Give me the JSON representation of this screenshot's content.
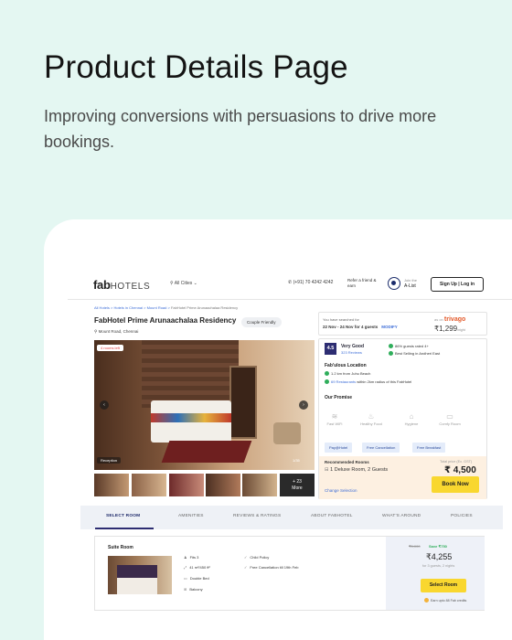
{
  "hero": {
    "title": "Product Details Page",
    "subtitle": "Improving conversions with persuasions to drive more bookings."
  },
  "header": {
    "logo_bold": "fab",
    "logo_rest": "HOTELS",
    "cities": "All Cities",
    "phone": "(+91) 70 4242 4242",
    "refer": "Refer a friend & earn",
    "alist_small": "Join the",
    "alist": "A-List",
    "signin": "Sign Up  |  Log in"
  },
  "breadcrumb": {
    "links": "All Hotels > Hotels in Chennai > Mount Road >",
    "current": "FabHotel Prime Arunaachalaa Residency"
  },
  "hotel": {
    "name": "FabHotel Prime Arunaachalaa Residency",
    "tag": "Couple Friendly",
    "address": "Mount Road, Chennai"
  },
  "gallery": {
    "rooms_left": "4 rooms left",
    "prev": "‹",
    "next": "›",
    "tag": "Reception",
    "counter": "1/35",
    "more_count": "+ 23",
    "more_label": "More"
  },
  "search": {
    "label": "You have searched for",
    "dates": "22 Nov - 24 Nov for 4 guests",
    "modify": "MODIFY",
    "as_on": "as on",
    "trivago": "trivago",
    "price": "₹1,299",
    "per": "/night"
  },
  "rating": {
    "score": "4.5",
    "label": "Very Good",
    "reviews": "323 Reviews",
    "c1": "86% guests rated 4+",
    "c2": "Best Selling in Andheri East"
  },
  "location": {
    "title": "Fab'ulous Location",
    "c1": "1.2 km from Juhu Beach",
    "c2_link": "69 Restaurants",
    "c2_rest": "within 2km radius of this FabHotel"
  },
  "promise": {
    "title": "Our Promise",
    "items": [
      "Fast WiFi",
      "Healthy Food",
      "Hygiene",
      "Comfy Room"
    ],
    "pills": [
      "Pay@Hotel",
      "Free Cancellation",
      "Free Breakfast"
    ]
  },
  "booking": {
    "title": "Recommended Rooms",
    "selection": "1 Deluxe Room, 2 Guests",
    "total_label": "Total price (Ex. GST)",
    "amount": "₹ 4,500",
    "button": "Book Now",
    "change": "Change Selection"
  },
  "tabs": [
    "SELECT ROOM",
    "AMENITIES",
    "REVIEWS & RATINGS",
    "ABOUT FABHOTEL",
    "WHAT'S AROUND",
    "POLICIES"
  ],
  "room": {
    "title": "Suite Room",
    "features_left": [
      "Fits 3",
      "41 m²/450 ft²",
      "Double Bed",
      "Balcony"
    ],
    "features_right": [
      "Child Policy",
      "Free Cancellation till 19th Feb"
    ],
    "strike_price": "₹5,000",
    "save": "Save ₹750",
    "price": "₹4,255",
    "guests": "for 3 guests, 2 nights",
    "button": "Select Room",
    "earn": "Earn upto 88 Fab credits"
  }
}
